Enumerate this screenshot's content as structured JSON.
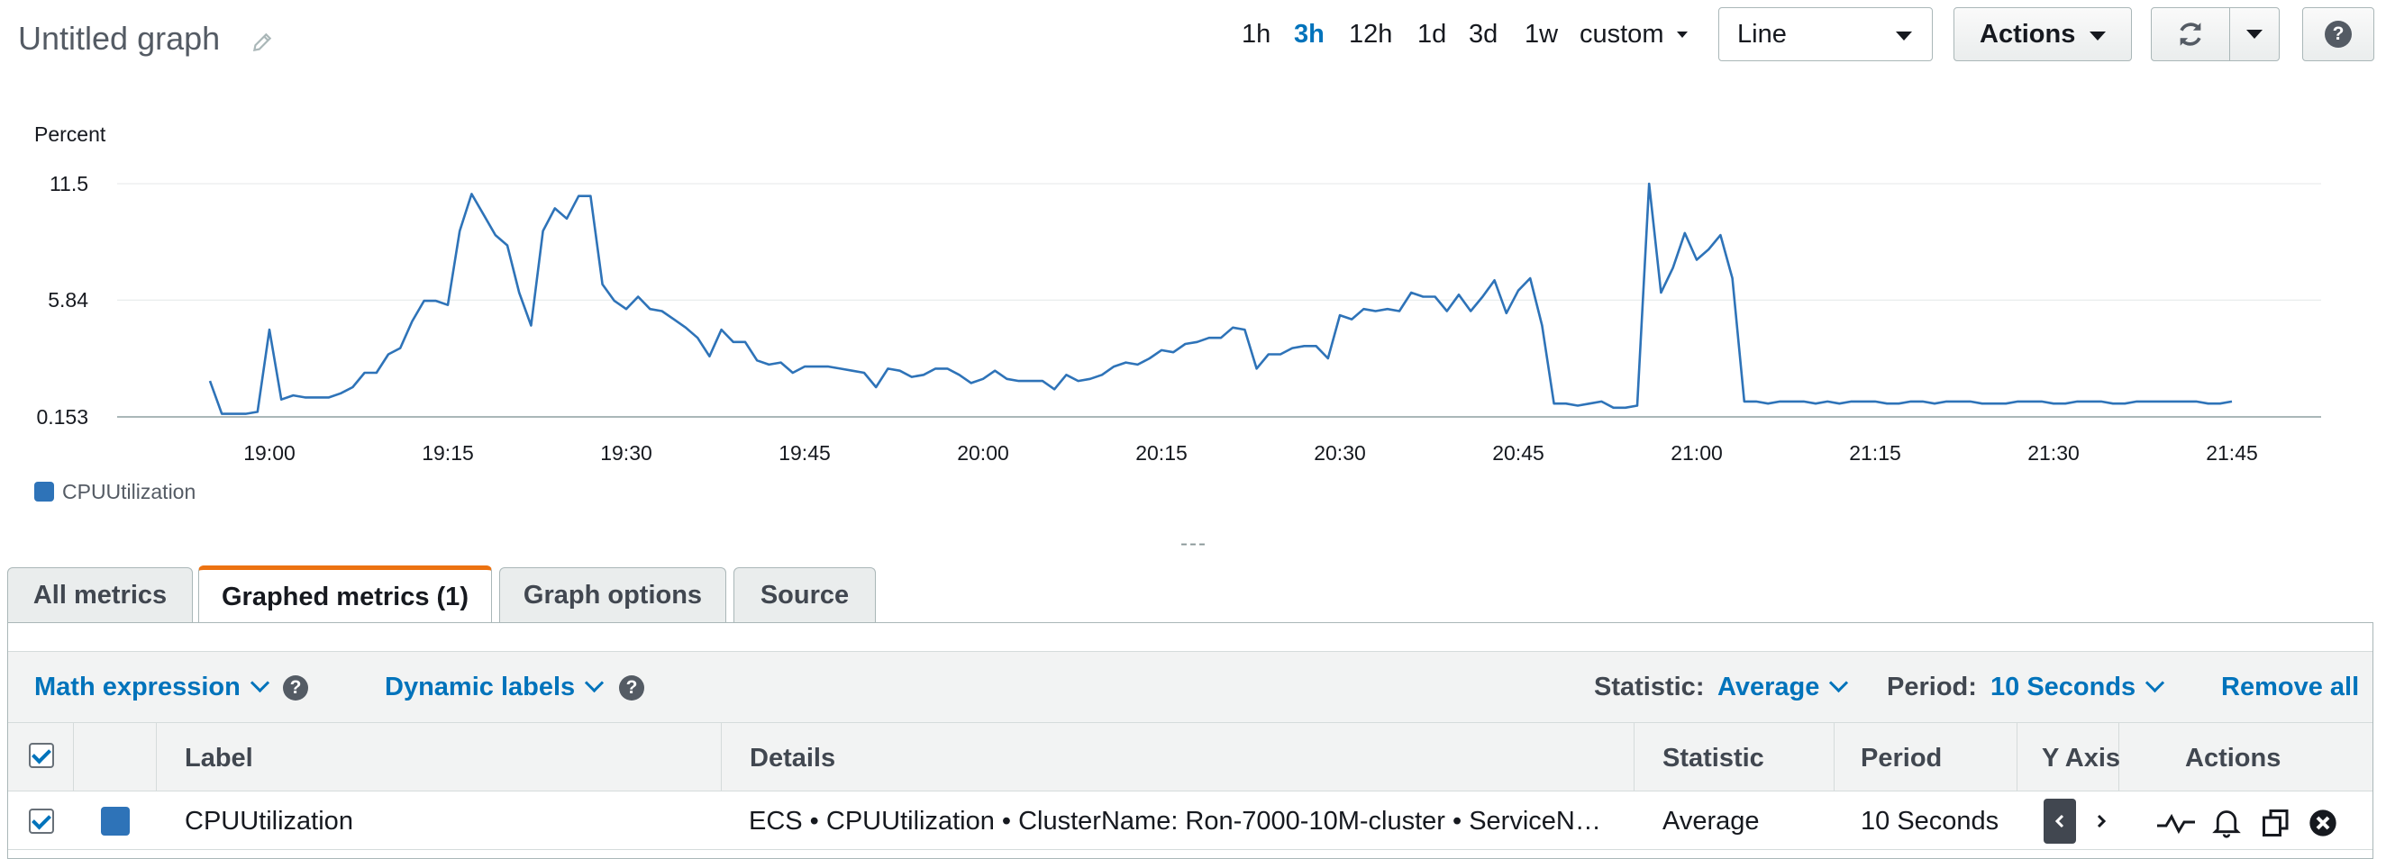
{
  "header": {
    "title": "Untitled graph",
    "time_ranges": [
      "1h",
      "3h",
      "12h",
      "1d",
      "3d",
      "1w",
      "custom"
    ],
    "active_range": "3h",
    "graph_type": "Line",
    "actions_label": "Actions",
    "help_label": "?"
  },
  "chart_data": {
    "type": "line",
    "ylabel": "Percent",
    "yticks": [
      "11.5",
      "5.84",
      "0.153"
    ],
    "ylim": [
      0.153,
      11.5
    ],
    "xticks": [
      "19:00",
      "19:15",
      "19:30",
      "19:45",
      "20:00",
      "20:15",
      "20:30",
      "20:45",
      "21:00",
      "21:15",
      "21:30",
      "21:45"
    ],
    "x_start": "18:55",
    "x_interval_seconds": 60,
    "grid": true,
    "legend_position": "bottom-left",
    "series": [
      {
        "name": "CPUUtilization",
        "color": "#2e73b8",
        "values": [
          1.9,
          0.3,
          0.3,
          0.3,
          0.4,
          4.4,
          1.0,
          1.2,
          1.1,
          1.1,
          1.1,
          1.3,
          1.6,
          2.3,
          2.3,
          3.2,
          3.5,
          4.8,
          5.8,
          5.8,
          5.6,
          9.2,
          11.0,
          10.0,
          9.0,
          8.5,
          6.2,
          4.6,
          9.2,
          10.3,
          9.8,
          10.9,
          10.9,
          6.6,
          5.8,
          5.4,
          6.0,
          5.4,
          5.3,
          4.9,
          4.5,
          4.0,
          3.1,
          4.4,
          3.8,
          3.8,
          2.9,
          2.7,
          2.8,
          2.3,
          2.6,
          2.6,
          2.6,
          2.5,
          2.4,
          2.3,
          1.6,
          2.5,
          2.4,
          2.1,
          2.2,
          2.5,
          2.5,
          2.2,
          1.8,
          2.0,
          2.4,
          2.0,
          1.9,
          1.9,
          1.9,
          1.5,
          2.2,
          1.9,
          2.0,
          2.2,
          2.6,
          2.8,
          2.7,
          3.0,
          3.4,
          3.3,
          3.7,
          3.8,
          4.0,
          4.0,
          4.5,
          4.4,
          2.5,
          3.2,
          3.2,
          3.5,
          3.6,
          3.6,
          3.0,
          5.1,
          4.9,
          5.4,
          5.3,
          5.4,
          5.3,
          6.2,
          6.0,
          6.0,
          5.3,
          6.1,
          5.3,
          6.0,
          6.8,
          5.2,
          6.3,
          6.9,
          4.6,
          0.8,
          0.8,
          0.7,
          0.8,
          0.9,
          0.6,
          0.6,
          0.7,
          11.5,
          6.2,
          7.4,
          9.1,
          7.8,
          8.3,
          9.0,
          6.9,
          0.9,
          0.9,
          0.8,
          0.9,
          0.9,
          0.9,
          0.8,
          0.9,
          0.8,
          0.9,
          0.9,
          0.9,
          0.8,
          0.8,
          0.9,
          0.9,
          0.8,
          0.9,
          0.9,
          0.9,
          0.8,
          0.8,
          0.8,
          0.9,
          0.9,
          0.9,
          0.8,
          0.8,
          0.9,
          0.9,
          0.9,
          0.8,
          0.8,
          0.9,
          0.9,
          0.9,
          0.9,
          0.9,
          0.9,
          0.8,
          0.8,
          0.9
        ]
      }
    ]
  },
  "splitter_label": "---",
  "tabs": [
    "All metrics",
    "Graphed metrics (1)",
    "Graph options",
    "Source"
  ],
  "active_tab": "Graphed metrics (1)",
  "toolbar": {
    "math_expression": "Math expression",
    "dynamic_labels": "Dynamic labels",
    "statistic_label": "Statistic:",
    "statistic_value": "Average",
    "period_label": "Period:",
    "period_value": "10 Seconds",
    "remove_all": "Remove all"
  },
  "table": {
    "columns": [
      "Label",
      "Details",
      "Statistic",
      "Period",
      "Y Axis",
      "Actions"
    ],
    "rows": [
      {
        "checked": true,
        "color": "#2e73b8",
        "label": "CPUUtilization",
        "details": "ECS • CPUUtilization • ClusterName: Ron-7000-10M-cluster • ServiceN…",
        "statistic": "Average",
        "period": "10 Seconds"
      }
    ]
  }
}
